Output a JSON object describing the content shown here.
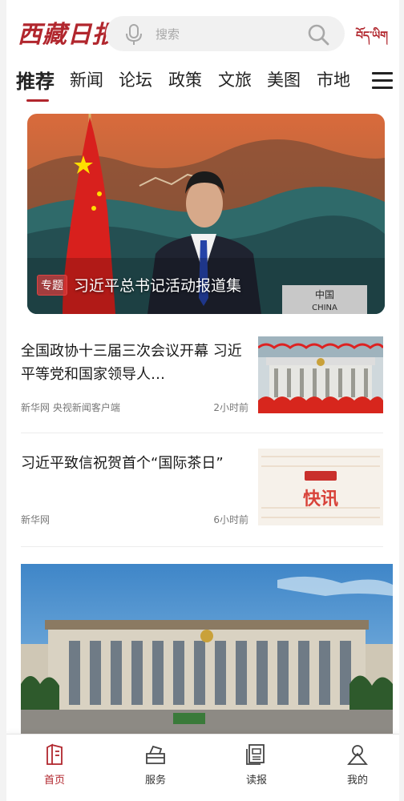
{
  "header": {
    "logo_text": "西藏日报",
    "search_placeholder": "搜索",
    "lang_link": "བོད་ཡིག"
  },
  "tabs": [
    {
      "label": "推荐",
      "active": true
    },
    {
      "label": "新闻"
    },
    {
      "label": "论坛"
    },
    {
      "label": "政策"
    },
    {
      "label": "文旅"
    },
    {
      "label": "美图"
    },
    {
      "label": "市地"
    }
  ],
  "banner": {
    "tag": "专题",
    "title": "习近平总书记活动报道集",
    "nameplate_cn": "中国",
    "nameplate_en": "CHINA"
  },
  "news": [
    {
      "title": "全国政协十三届三次会议开幕 习近平等党和国家领导人…",
      "source": "新华网 央视新闻客户端",
      "time": "2小时前"
    },
    {
      "title": "习近平致信祝贺首个“国际茶日”",
      "source": "新华网",
      "time": "6小时前",
      "thumb_text": "快讯"
    }
  ],
  "bottom_nav": [
    {
      "label": "首页",
      "icon": "home-icon",
      "active": true
    },
    {
      "label": "服务",
      "icon": "service-icon"
    },
    {
      "label": "读报",
      "icon": "newspaper-icon"
    },
    {
      "label": "我的",
      "icon": "profile-icon"
    }
  ],
  "colors": {
    "accent": "#b1262d",
    "text": "#222222",
    "meta": "#777777"
  }
}
